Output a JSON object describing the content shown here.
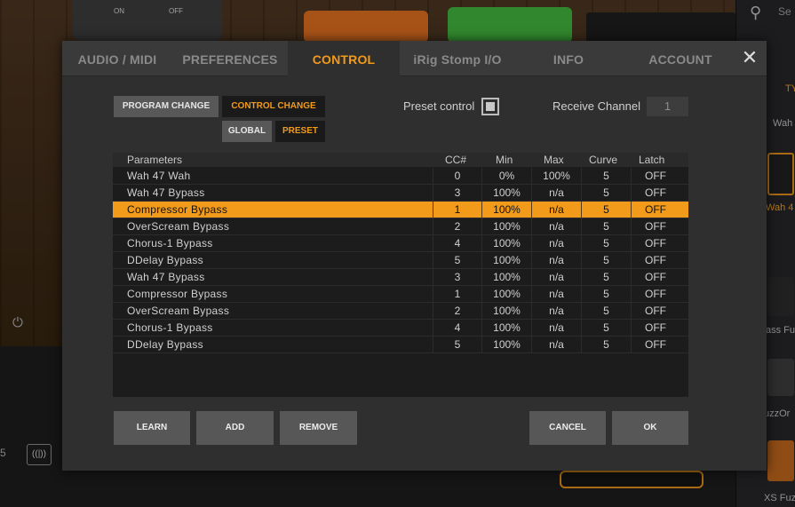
{
  "background": {
    "search_placeholder": "Se",
    "switch_on": "ON",
    "switch_off": "OFF",
    "side_labels": [
      "Wah",
      "Wah 4",
      "ass Fu",
      "uzzOr",
      "XS Fuz"
    ],
    "side_tab": "TY",
    "left_text": "5"
  },
  "tabs": [
    {
      "label": "AUDIO / MIDI",
      "active": false
    },
    {
      "label": "PREFERENCES",
      "active": false
    },
    {
      "label": "CONTROL",
      "active": true
    },
    {
      "label": "iRig Stomp I/O",
      "active": false
    },
    {
      "label": "INFO",
      "active": false
    },
    {
      "label": "ACCOUNT",
      "active": false
    }
  ],
  "close_label": "✕",
  "mode": {
    "program_change": "PROGRAM CHANGE",
    "control_change": "CONTROL CHANGE",
    "global": "GLOBAL",
    "preset": "PRESET",
    "selected_mode": "CONTROL CHANGE",
    "selected_scope": "PRESET"
  },
  "preset_control": {
    "label": "Preset control",
    "checked": true
  },
  "receive_channel": {
    "label": "Receive Channel",
    "value": "1"
  },
  "table": {
    "headers": [
      "Parameters",
      "CC#",
      "Min",
      "Max",
      "Curve",
      "Latch"
    ],
    "selected_index": 2,
    "rows": [
      {
        "name": "Wah 47 Wah",
        "cc": "0",
        "min": "0%",
        "max": "100%",
        "curve": "5",
        "latch": "OFF"
      },
      {
        "name": "Wah 47 Bypass",
        "cc": "3",
        "min": "100%",
        "max": "n/a",
        "curve": "5",
        "latch": "OFF"
      },
      {
        "name": "Compressor Bypass",
        "cc": "1",
        "min": "100%",
        "max": "n/a",
        "curve": "5",
        "latch": "OFF"
      },
      {
        "name": "OverScream Bypass",
        "cc": "2",
        "min": "100%",
        "max": "n/a",
        "curve": "5",
        "latch": "OFF"
      },
      {
        "name": "Chorus-1 Bypass",
        "cc": "4",
        "min": "100%",
        "max": "n/a",
        "curve": "5",
        "latch": "OFF"
      },
      {
        "name": "DDelay Bypass",
        "cc": "5",
        "min": "100%",
        "max": "n/a",
        "curve": "5",
        "latch": "OFF"
      },
      {
        "name": "Wah 47 Bypass",
        "cc": "3",
        "min": "100%",
        "max": "n/a",
        "curve": "5",
        "latch": "OFF"
      },
      {
        "name": "Compressor Bypass",
        "cc": "1",
        "min": "100%",
        "max": "n/a",
        "curve": "5",
        "latch": "OFF"
      },
      {
        "name": "OverScream Bypass",
        "cc": "2",
        "min": "100%",
        "max": "n/a",
        "curve": "5",
        "latch": "OFF"
      },
      {
        "name": "Chorus-1 Bypass",
        "cc": "4",
        "min": "100%",
        "max": "n/a",
        "curve": "5",
        "latch": "OFF"
      },
      {
        "name": "DDelay Bypass",
        "cc": "5",
        "min": "100%",
        "max": "n/a",
        "curve": "5",
        "latch": "OFF"
      }
    ]
  },
  "buttons": {
    "learn": "LEARN",
    "add": "ADD",
    "remove": "REMOVE",
    "cancel": "CANCEL",
    "ok": "OK"
  },
  "colors": {
    "accent": "#f29a1a",
    "modal_bg": "#2f2f2f",
    "button_bg": "#575757"
  }
}
